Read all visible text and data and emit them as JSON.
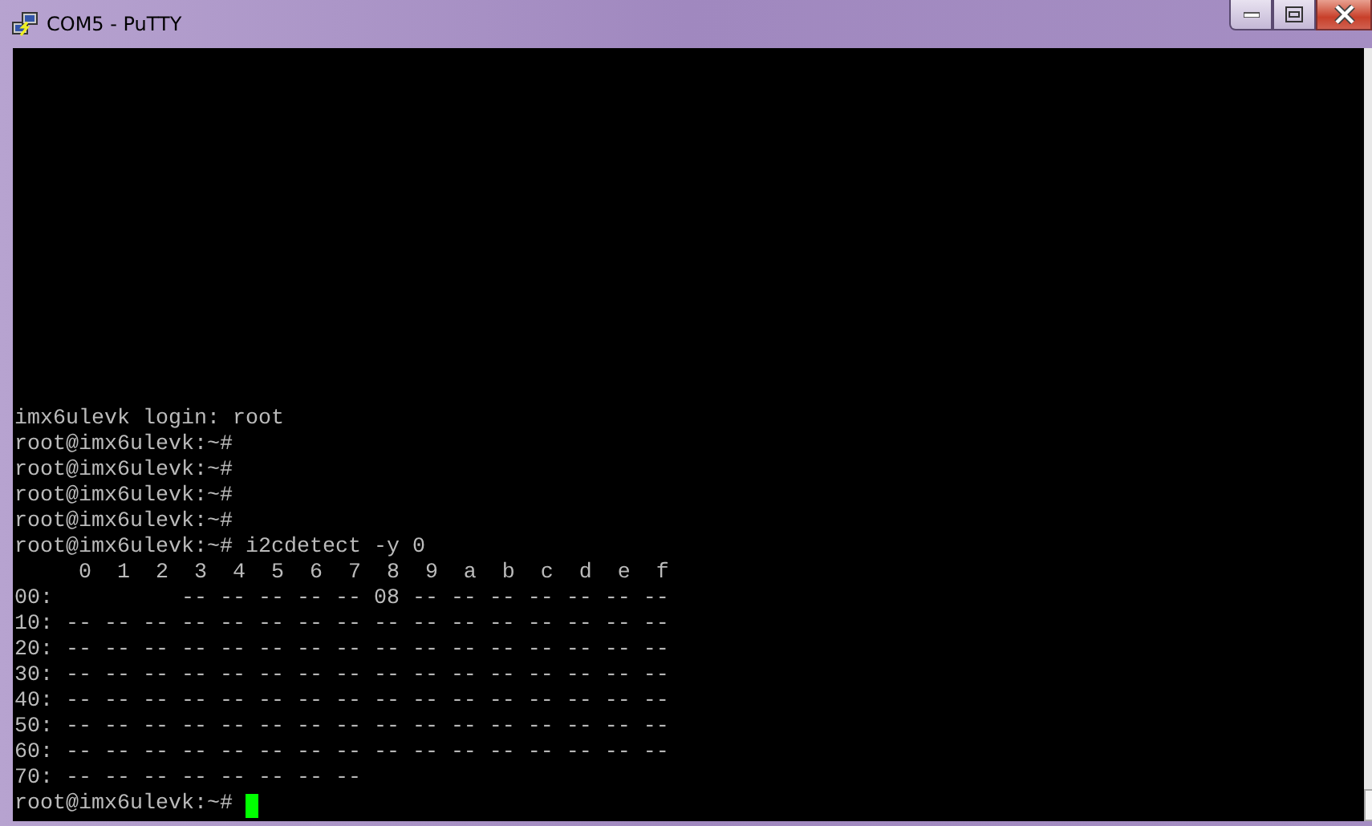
{
  "window": {
    "title": "COM5 - PuTTY"
  },
  "terminal": {
    "lines": [
      "imx6ulevk login: root",
      "root@imx6ulevk:~#",
      "root@imx6ulevk:~#",
      "root@imx6ulevk:~#",
      "root@imx6ulevk:~#",
      "root@imx6ulevk:~# i2cdetect -y 0",
      "     0  1  2  3  4  5  6  7  8  9  a  b  c  d  e  f",
      "00:          -- -- -- -- -- 08 -- -- -- -- -- -- --",
      "10: -- -- -- -- -- -- -- -- -- -- -- -- -- -- -- --",
      "20: -- -- -- -- -- -- -- -- -- -- -- -- -- -- -- --",
      "30: -- -- -- -- -- -- -- -- -- -- -- -- -- -- -- --",
      "40: -- -- -- -- -- -- -- -- -- -- -- -- -- -- -- --",
      "50: -- -- -- -- -- -- -- -- -- -- -- -- -- -- -- --",
      "60: -- -- -- -- -- -- -- -- -- -- -- -- -- -- -- --",
      "70: -- -- -- -- -- -- -- --"
    ],
    "prompt": "root@imx6ulevk:~#",
    "cursor": true
  }
}
